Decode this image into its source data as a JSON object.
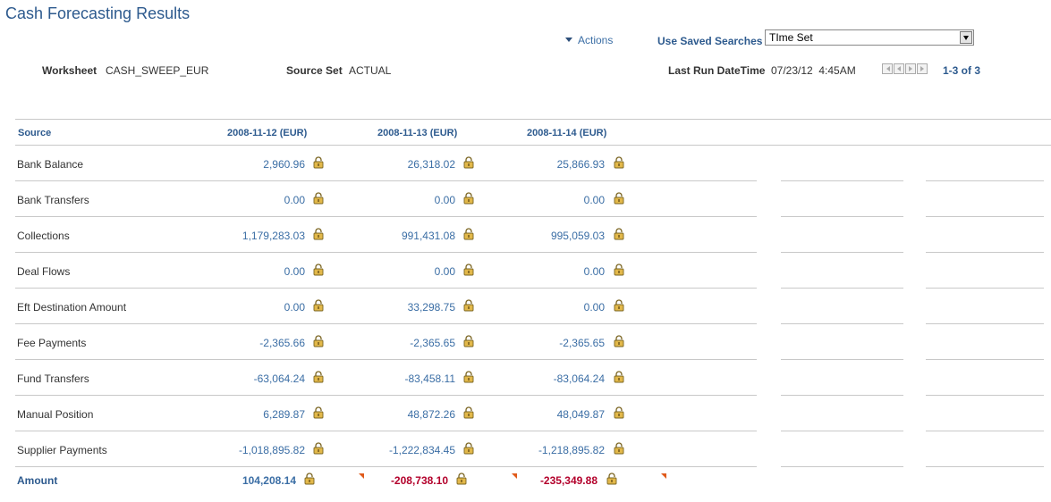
{
  "page": {
    "title": "Cash Forecasting Results"
  },
  "toolbar": {
    "actions_label": "Actions",
    "saved_searches_label": "Use Saved Searches",
    "saved_searches_value": "TIme Set"
  },
  "info": {
    "worksheet_label": "Worksheet",
    "worksheet_value": "CASH_SWEEP_EUR",
    "source_set_label": "Source Set",
    "source_set_value": "ACTUAL",
    "last_run_label": "Last Run DateTime",
    "last_run_value": "07/23/12  4:45AM"
  },
  "pager": {
    "text": "1-3 of 3"
  },
  "grid": {
    "headers": [
      "Source",
      "2008-11-12 (EUR)",
      "2008-11-13 (EUR)",
      "2008-11-14 (EUR)"
    ],
    "rows": [
      {
        "source": "Bank Balance",
        "values": [
          "2,960.96",
          "26,318.02",
          "25,866.93"
        ]
      },
      {
        "source": "Bank Transfers",
        "values": [
          "0.00",
          "0.00",
          "0.00"
        ]
      },
      {
        "source": "Collections",
        "values": [
          "1,179,283.03",
          "991,431.08",
          "995,059.03"
        ]
      },
      {
        "source": "Deal Flows",
        "values": [
          "0.00",
          "0.00",
          "0.00"
        ]
      },
      {
        "source": "Eft Destination Amount",
        "values": [
          "0.00",
          "33,298.75",
          "0.00"
        ]
      },
      {
        "source": "Fee Payments",
        "values": [
          "-2,365.66",
          "-2,365.65",
          "-2,365.65"
        ]
      },
      {
        "source": "Fund Transfers",
        "values": [
          "-63,064.24",
          "-83,458.11",
          "-83,064.24"
        ]
      },
      {
        "source": "Manual Position",
        "values": [
          "6,289.87",
          "48,872.26",
          "48,049.87"
        ]
      },
      {
        "source": "Supplier Payments",
        "values": [
          "-1,018,895.82",
          "-1,222,834.45",
          "-1,218,895.82"
        ]
      }
    ],
    "total": {
      "label": "Amount",
      "values": [
        "104,208.14",
        "-208,738.10",
        "-235,349.88"
      ]
    }
  },
  "colors": {
    "link": "#2d5a8e",
    "negative": "#b3002b",
    "lock": "#c9a23a"
  }
}
